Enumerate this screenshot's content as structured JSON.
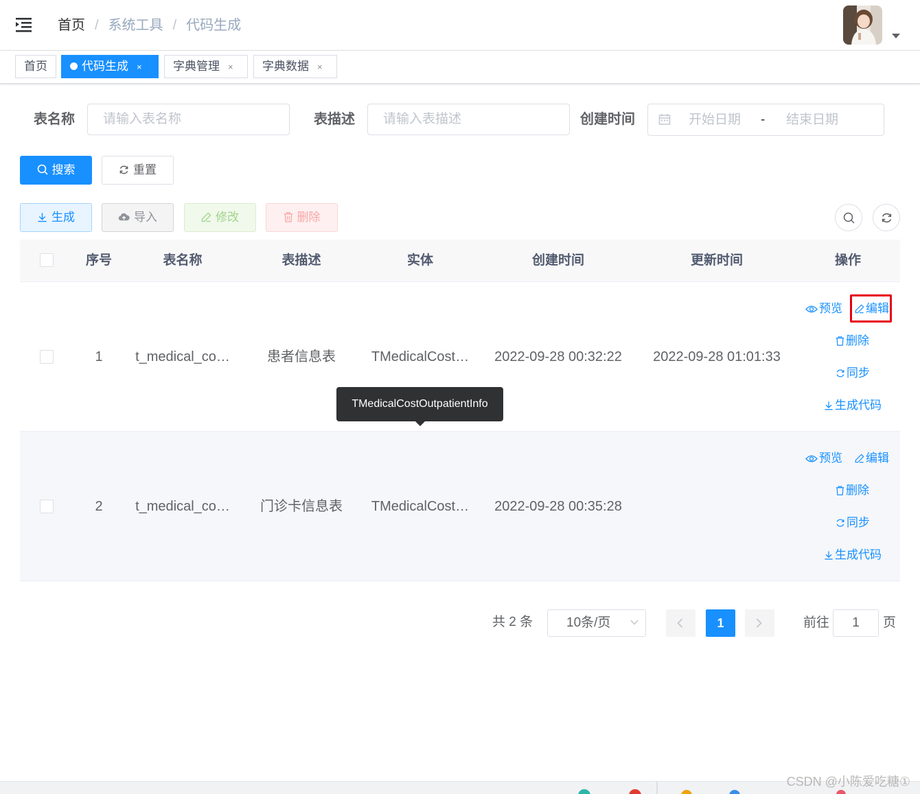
{
  "header": {
    "breadcrumb": [
      "首页",
      "系统工具",
      "代码生成"
    ],
    "separator": "/"
  },
  "tags": [
    {
      "label": "首页",
      "active": false,
      "closable": false
    },
    {
      "label": "代码生成",
      "active": true,
      "closable": true
    },
    {
      "label": "字典管理",
      "active": false,
      "closable": true
    },
    {
      "label": "字典数据",
      "active": false,
      "closable": true
    }
  ],
  "tag_close": "×",
  "search": {
    "table_name_label": "表名称",
    "table_name_placeholder": "请输入表名称",
    "table_desc_label": "表描述",
    "table_desc_placeholder": "请输入表描述",
    "created_label": "创建时间",
    "start_placeholder": "开始日期",
    "range_separator": "-",
    "end_placeholder": "结束日期",
    "search_button": "搜索",
    "reset_button": "重置"
  },
  "toolbar": {
    "generate": "生成",
    "import": "导入",
    "edit": "修改",
    "delete": "删除"
  },
  "table": {
    "columns": [
      "序号",
      "表名称",
      "表描述",
      "实体",
      "创建时间",
      "更新时间",
      "操作"
    ],
    "rows": [
      {
        "index": "1",
        "table_name": "t_medical_co…",
        "table_desc": "患者信息表",
        "entity": "TMedicalCost…",
        "created": "2022-09-28 00:32:22",
        "updated": "2022-09-28 01:01:33"
      },
      {
        "index": "2",
        "table_name": "t_medical_co…",
        "table_desc": "门诊卡信息表",
        "entity": "TMedicalCost…",
        "created": "2022-09-28 00:35:28",
        "updated": ""
      }
    ],
    "actions": {
      "preview": "预览",
      "edit": "编辑",
      "delete": "删除",
      "sync": "同步",
      "gen_code": "生成代码"
    },
    "tooltip": "TMedicalCostOutpatientInfo"
  },
  "pagination": {
    "total_text": "共 2 条",
    "page_size": "10条/页",
    "current_page": "1",
    "goto_label": "前往",
    "goto_value": "1",
    "page_unit": "页"
  },
  "watermark": "CSDN @小陈爱吃糖①",
  "colors": {
    "primary": "#1890ff",
    "highlight_border": "#e60012",
    "tooltip_bg": "#303133"
  }
}
